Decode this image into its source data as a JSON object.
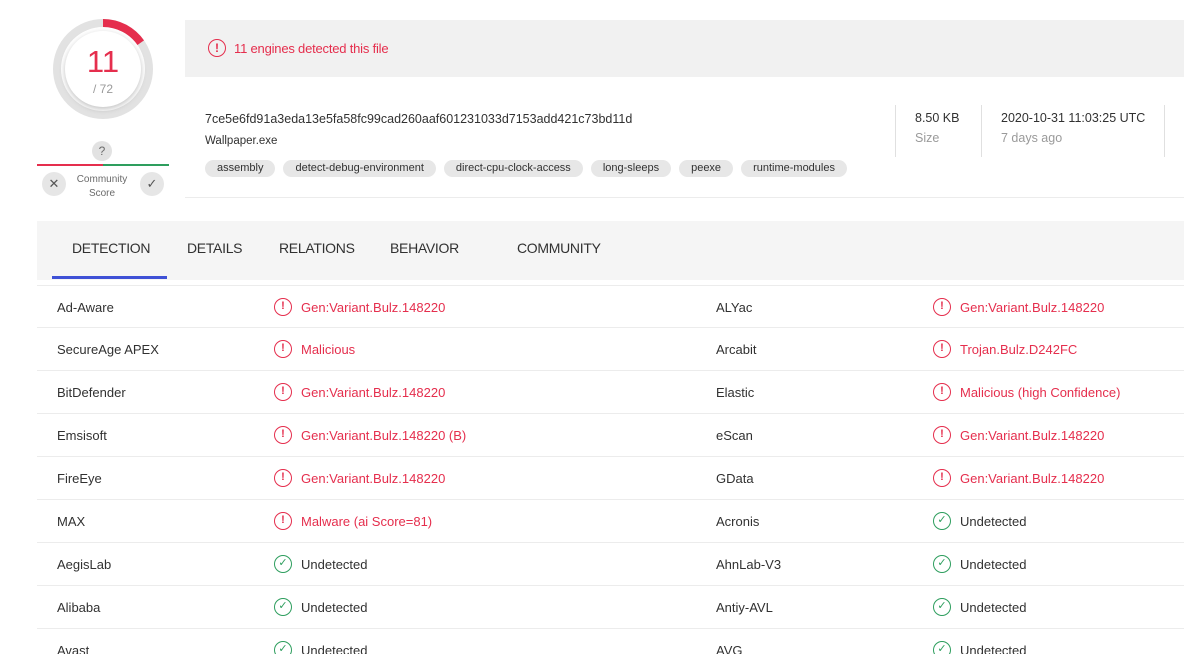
{
  "score": {
    "detected": "11",
    "total": "/ 72",
    "ratio": 0.1528
  },
  "community": {
    "question": "?",
    "label_line1": "Community",
    "label_line2": "Score",
    "down_symbol": "✕",
    "up_symbol": "✓"
  },
  "alert": {
    "icon": "!",
    "text": "11 engines detected this file"
  },
  "file": {
    "hash": "7ce5e6fd91a3eda13e5fa58fc99cad260aaf601231033d7153add421c73bd11d",
    "name": "Wallpaper.exe",
    "tags": [
      "assembly",
      "detect-debug-environment",
      "direct-cpu-clock-access",
      "long-sleeps",
      "peexe",
      "runtime-modules"
    ],
    "size_value": "8.50 KB",
    "size_label": "Size",
    "date_value": "2020-10-31 11:03:25 UTC",
    "date_relative": "7 days ago"
  },
  "tabs": [
    {
      "label": "DETECTION",
      "active": true
    },
    {
      "label": "DETAILS",
      "active": false
    },
    {
      "label": "RELATIONS",
      "active": false
    },
    {
      "label": "BEHAVIOR",
      "active": false
    },
    {
      "label": "COMMUNITY",
      "active": false
    }
  ],
  "detections": [
    {
      "left_engine": "Ad-Aware",
      "left_result": "Gen:Variant.Bulz.148220",
      "left_status": "malicious",
      "right_engine": "ALYac",
      "right_result": "Gen:Variant.Bulz.148220",
      "right_status": "malicious"
    },
    {
      "left_engine": "SecureAge APEX",
      "left_result": "Malicious",
      "left_status": "malicious",
      "right_engine": "Arcabit",
      "right_result": "Trojan.Bulz.D242FC",
      "right_status": "malicious"
    },
    {
      "left_engine": "BitDefender",
      "left_result": "Gen:Variant.Bulz.148220",
      "left_status": "malicious",
      "right_engine": "Elastic",
      "right_result": "Malicious (high Confidence)",
      "right_status": "malicious"
    },
    {
      "left_engine": "Emsisoft",
      "left_result": "Gen:Variant.Bulz.148220 (B)",
      "left_status": "malicious",
      "right_engine": "eScan",
      "right_result": "Gen:Variant.Bulz.148220",
      "right_status": "malicious"
    },
    {
      "left_engine": "FireEye",
      "left_result": "Gen:Variant.Bulz.148220",
      "left_status": "malicious",
      "right_engine": "GData",
      "right_result": "Gen:Variant.Bulz.148220",
      "right_status": "malicious"
    },
    {
      "left_engine": "MAX",
      "left_result": "Malware (ai Score=81)",
      "left_status": "malicious",
      "right_engine": "Acronis",
      "right_result": "Undetected",
      "right_status": "undetected"
    },
    {
      "left_engine": "AegisLab",
      "left_result": "Undetected",
      "left_status": "undetected",
      "right_engine": "AhnLab-V3",
      "right_result": "Undetected",
      "right_status": "undetected"
    },
    {
      "left_engine": "Alibaba",
      "left_result": "Undetected",
      "left_status": "undetected",
      "right_engine": "Antiy-AVL",
      "right_result": "Undetected",
      "right_status": "undetected"
    },
    {
      "left_engine": "Avast",
      "left_result": "Undetected",
      "left_status": "undetected",
      "right_engine": "AVG",
      "right_result": "Undetected",
      "right_status": "undetected"
    }
  ],
  "icons": {
    "malicious": "alert-circle-icon",
    "undetected": "check-circle-icon"
  },
  "colors": {
    "malicious": "#e52e4d",
    "undetected": "#2e9e5e",
    "accent": "#3f51d6"
  }
}
